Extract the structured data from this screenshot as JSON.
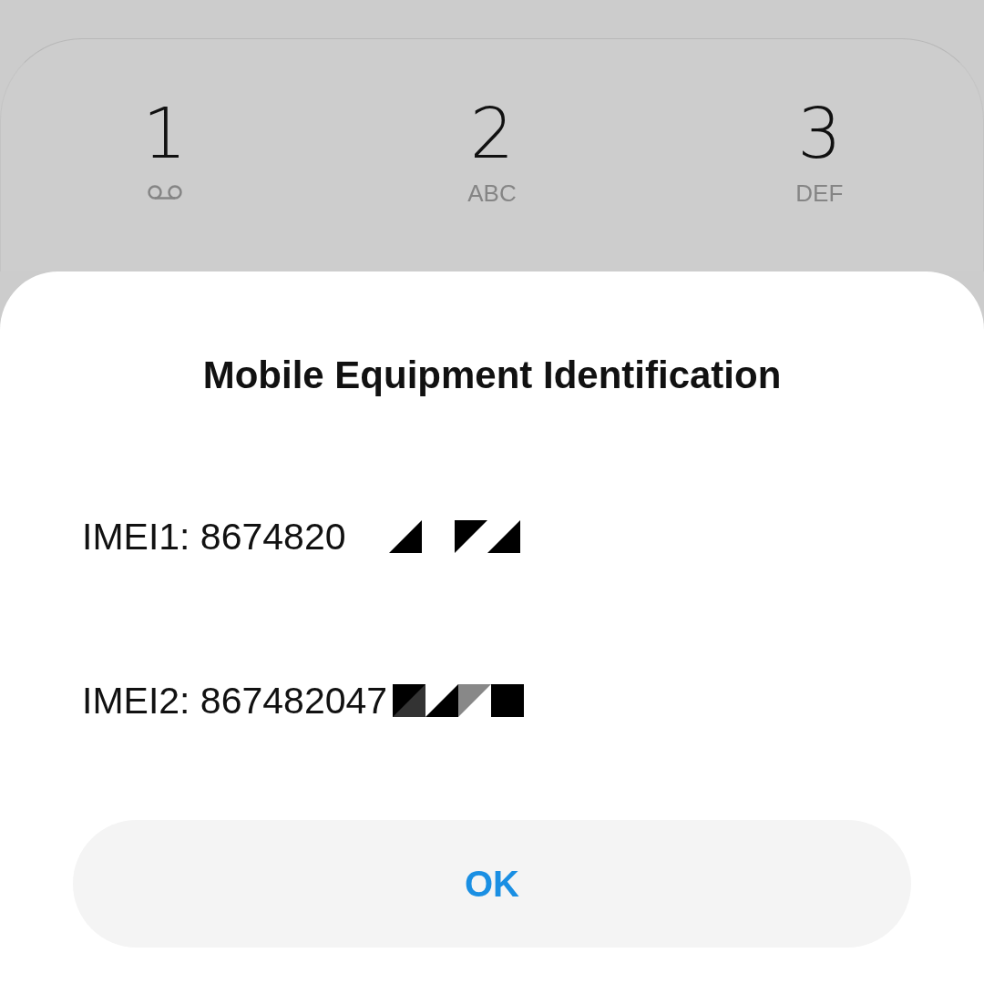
{
  "keypad": [
    {
      "digit": "1",
      "kind": "voicemail"
    },
    {
      "digit": "2",
      "kind": "letters",
      "letters": "ABC"
    },
    {
      "digit": "3",
      "kind": "letters",
      "letters": "DEF"
    }
  ],
  "dialog": {
    "title": "Mobile Equipment Identification",
    "lines": [
      {
        "text": "IMEI1: 8674820",
        "kind": "redacted"
      },
      {
        "text": "IMEI2: 867482047",
        "kind": "redacted"
      }
    ],
    "button": "OK"
  }
}
